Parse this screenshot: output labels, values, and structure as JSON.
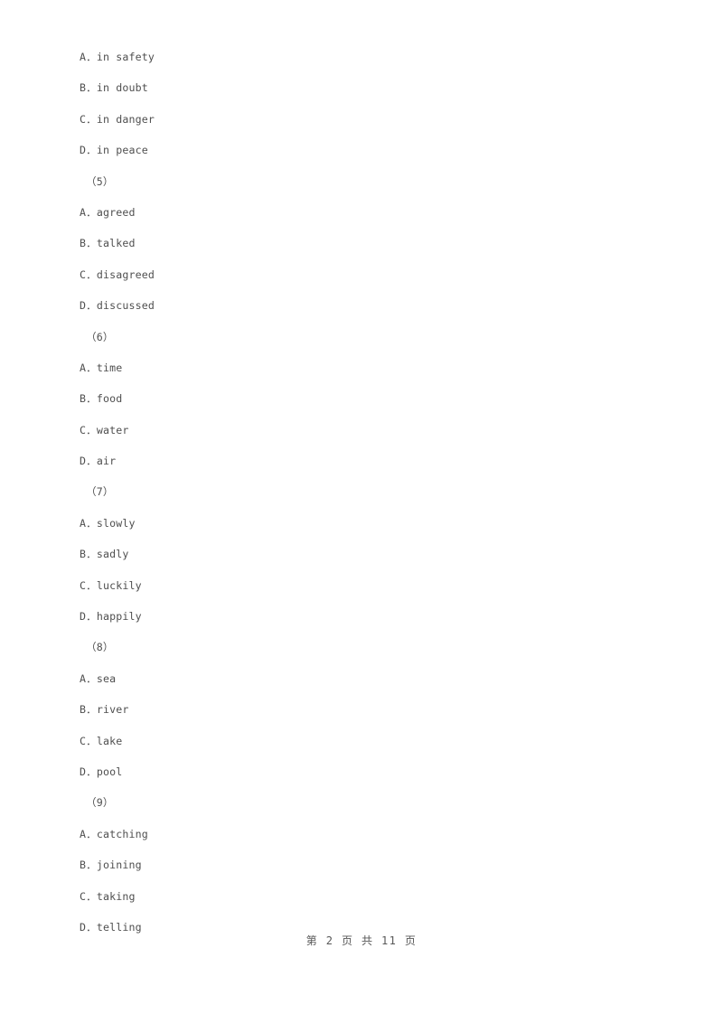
{
  "document": {
    "page_background": "#ffffff",
    "text_color": "#4f4f4f",
    "footer_color": "#585858"
  },
  "body_lines": [
    {
      "kind": "option",
      "text": "A．in safety"
    },
    {
      "kind": "option",
      "text": "B．in doubt"
    },
    {
      "kind": "option",
      "text": "C．in danger"
    },
    {
      "kind": "option",
      "text": "D．in peace"
    },
    {
      "kind": "group",
      "text": "（5）"
    },
    {
      "kind": "option",
      "text": "A．agreed"
    },
    {
      "kind": "option",
      "text": "B．talked"
    },
    {
      "kind": "option",
      "text": "C．disagreed"
    },
    {
      "kind": "option",
      "text": "D．discussed"
    },
    {
      "kind": "group",
      "text": "（6）"
    },
    {
      "kind": "option",
      "text": "A．time"
    },
    {
      "kind": "option",
      "text": "B．food"
    },
    {
      "kind": "option",
      "text": "C．water"
    },
    {
      "kind": "option",
      "text": "D．air"
    },
    {
      "kind": "group",
      "text": "（7）"
    },
    {
      "kind": "option",
      "text": "A．slowly"
    },
    {
      "kind": "option",
      "text": "B．sadly"
    },
    {
      "kind": "option",
      "text": "C．luckily"
    },
    {
      "kind": "option",
      "text": "D．happily"
    },
    {
      "kind": "group",
      "text": "（8）"
    },
    {
      "kind": "option",
      "text": "A．sea"
    },
    {
      "kind": "option",
      "text": "B．river"
    },
    {
      "kind": "option",
      "text": "C．lake"
    },
    {
      "kind": "option",
      "text": "D．pool"
    },
    {
      "kind": "group",
      "text": "（9）"
    },
    {
      "kind": "option",
      "text": "A．catching"
    },
    {
      "kind": "option",
      "text": "B．joining"
    },
    {
      "kind": "option",
      "text": "C．taking"
    },
    {
      "kind": "option",
      "text": "D．telling"
    }
  ],
  "footer": {
    "text": "第 2 页 共 11 页",
    "current_page": "2",
    "total_pages": "11"
  }
}
